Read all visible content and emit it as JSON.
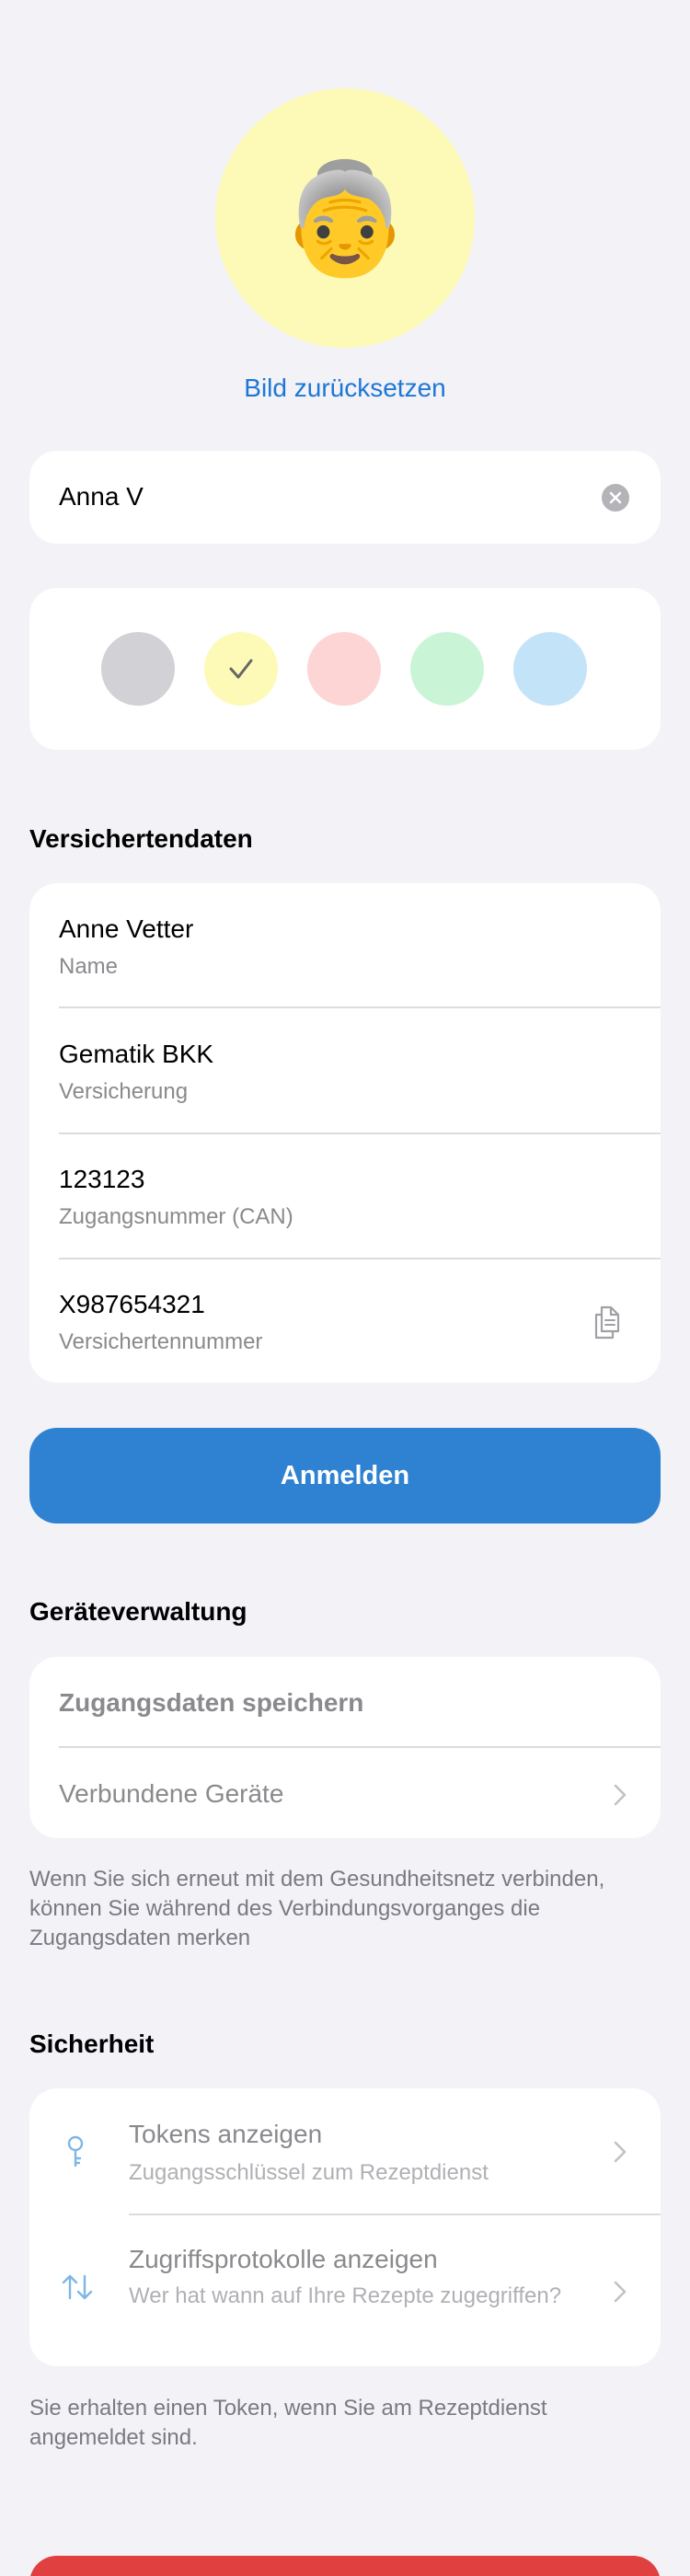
{
  "profile": {
    "reset_picture_label": "Bild zurücksetzen",
    "name_value": "Anna V",
    "avatar_emoji": "👵",
    "avatar_background": "#fdfab7",
    "colors": [
      {
        "name": "grey",
        "hex": "#d2d2d6",
        "selected": false
      },
      {
        "name": "yellow",
        "hex": "#fdfab7",
        "selected": true
      },
      {
        "name": "pink",
        "hex": "#fdd5d4",
        "selected": false
      },
      {
        "name": "green",
        "hex": "#c9f5d6",
        "selected": false
      },
      {
        "name": "blue",
        "hex": "#c3e3f9",
        "selected": false
      }
    ]
  },
  "insured": {
    "section_title": "Versichertendaten",
    "rows": [
      {
        "value": "Anne Vetter",
        "label": "Name"
      },
      {
        "value": "Gematik BKK",
        "label": "Versicherung"
      },
      {
        "value": "123123",
        "label": "Zugangsnummer (CAN)"
      },
      {
        "value": "X987654321",
        "label": "Versichertennummer"
      }
    ],
    "login_label": "Anmelden"
  },
  "devices": {
    "section_title": "Geräteverwaltung",
    "save_credentials_label": "Zugangsdaten speichern",
    "connected_devices_label": "Verbundene Geräte",
    "footnote": "Wenn Sie sich erneut mit dem Gesundheitsnetz verbinden, können Sie während des Verbindungsvorganges die Zugangsdaten merken"
  },
  "security": {
    "section_title": "Sicherheit",
    "items": [
      {
        "title": "Tokens anzeigen",
        "subtitle": "Zugangsschlüssel zum Rezeptdienst",
        "icon": "key-icon"
      },
      {
        "title": "Zugriffsprotokolle anzeigen",
        "subtitle": "Wer hat wann auf Ihre Rezepte zugegriffen?",
        "icon": "arrows-up-down-icon"
      }
    ],
    "footnote": "Sie erhalten einen Token, wenn Sie am Rezeptdienst angemeldet sind."
  },
  "theme": {
    "accent": "#1e77d6",
    "login_button": "#2f82d2",
    "destructive": "#e04040",
    "background": "#f2f2f7"
  }
}
